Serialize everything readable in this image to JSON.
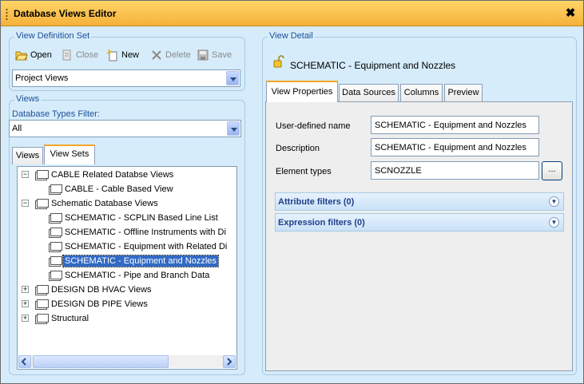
{
  "window": {
    "title": "Database Views Editor",
    "close_glyph": "✖"
  },
  "view_definition_set": {
    "title": "View Definition Set",
    "toolbar": {
      "open": "Open",
      "close": "Close",
      "new": "New",
      "delete": "Delete",
      "save": "Save"
    },
    "selected": "Project Views"
  },
  "views": {
    "title": "Views",
    "filter_label": "Database Types Filter:",
    "filter_value": "All",
    "tabs": [
      {
        "label": "Views"
      },
      {
        "label": "View Sets"
      }
    ],
    "tree": [
      {
        "label": "CABLE Related Databse Views",
        "level": 0,
        "expanded": true
      },
      {
        "label": "CABLE - Cable Based View",
        "level": 1
      },
      {
        "label": "Schematic Database Views",
        "level": 0,
        "expanded": true
      },
      {
        "label": "SCHEMATIC - SCPLIN Based Line List",
        "level": 1
      },
      {
        "label": "SCHEMATIC - Offline Instruments with Di",
        "level": 1
      },
      {
        "label": "SCHEMATIC - Equipment with Related Di",
        "level": 1
      },
      {
        "label": "SCHEMATIC - Equipment and Nozzles",
        "level": 1,
        "selected": true
      },
      {
        "label": "SCHEMATIC - Pipe and Branch Data",
        "level": 1
      },
      {
        "label": "DESIGN DB HVAC Views",
        "level": 0,
        "expanded": false
      },
      {
        "label": "DESIGN DB PIPE Views",
        "level": 0,
        "expanded": false
      },
      {
        "label": "Structural",
        "level": 0,
        "expanded": false
      }
    ]
  },
  "view_detail": {
    "title": "View Detail",
    "heading": "SCHEMATIC - Equipment and Nozzles",
    "tabs": [
      {
        "label": "View Properties"
      },
      {
        "label": "Data Sources"
      },
      {
        "label": "Columns"
      },
      {
        "label": "Preview"
      }
    ],
    "fields": {
      "user_defined_name": {
        "label": "User-defined name",
        "value": "SCHEMATIC - Equipment and Nozzles"
      },
      "description": {
        "label": "Description",
        "value": "SCHEMATIC - Equipment and Nozzles"
      },
      "element_types": {
        "label": "Element types",
        "value": "SCNOZZLE",
        "browse": "..."
      }
    },
    "filters": {
      "attribute": "Attribute filters (0)",
      "expression": "Expression filters (0)"
    }
  },
  "colors": {
    "titlebar": "#f6b13a",
    "background": "#d6ecfa",
    "group_title": "#1f4f9a",
    "selection": "#316ac5",
    "active_tab_accent": "#f5a626"
  },
  "icons": [
    "open-folder-icon",
    "close-icon",
    "new-icon",
    "delete-icon",
    "save-icon",
    "lock-icon",
    "folder-icon",
    "chevron-down-icon"
  ]
}
